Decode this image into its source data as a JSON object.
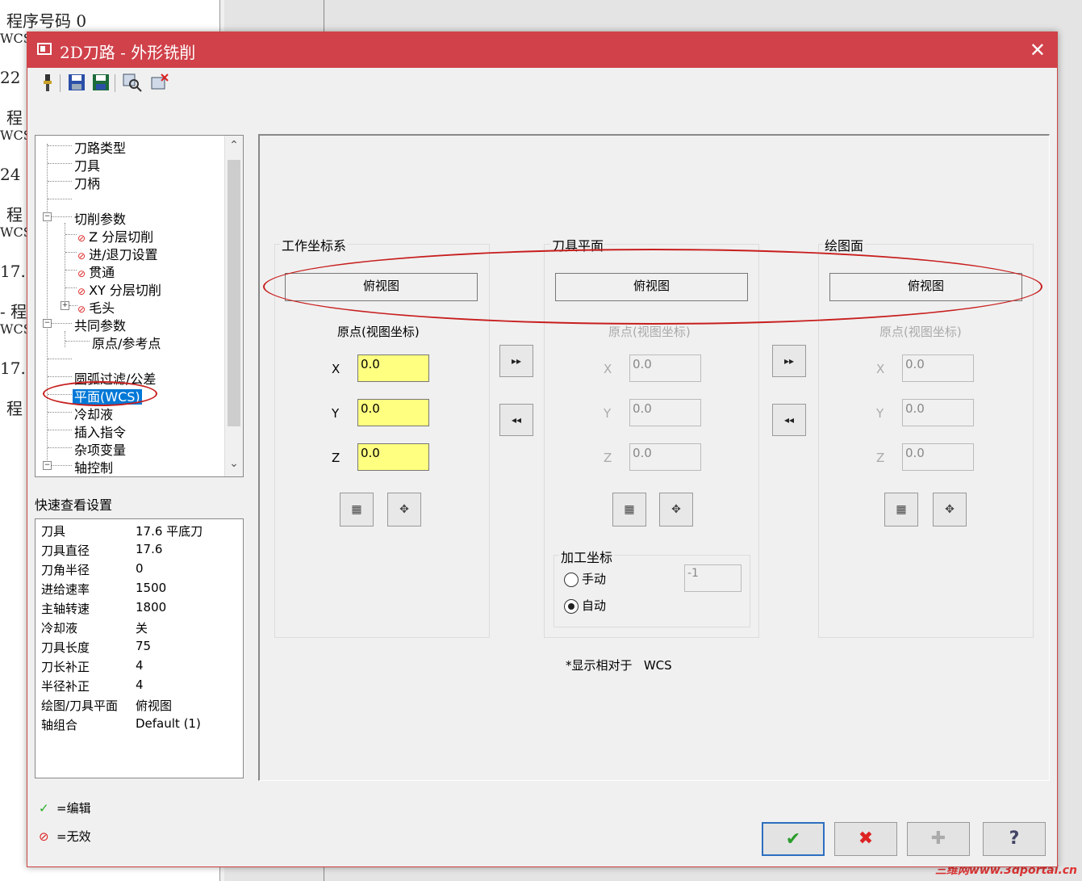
{
  "background": {
    "lines": [
      "程序号码 0",
      "WCS",
      "22",
      "程",
      "WCS",
      "24",
      "程",
      "WCS",
      "17.",
      "- 程",
      "WCS",
      "17.",
      "程"
    ],
    "watermark": "三维网www.3dportal.cn"
  },
  "window": {
    "title": "2D刀路 - 外形铣削",
    "close_label": "✕",
    "accent_color": "#d0414a"
  },
  "toolbar": {
    "icons": [
      "tool-icon",
      "save-icon",
      "save-all-icon",
      "preview-icon",
      "delete-icon"
    ]
  },
  "tree": {
    "items": [
      {
        "label": "刀路类型"
      },
      {
        "label": "刀具"
      },
      {
        "label": "刀柄"
      },
      {
        "label": "切削参数",
        "expander": "−"
      },
      {
        "label": "Z 分层切削"
      },
      {
        "label": "进/退刀设置"
      },
      {
        "label": "贯通"
      },
      {
        "label": "XY 分层切削"
      },
      {
        "label": "毛头",
        "expander": "+"
      },
      {
        "label": "共同参数",
        "expander": "−"
      },
      {
        "label": "原点/参考点"
      },
      {
        "label": "圆弧过滤/公差"
      },
      {
        "label": "平面(WCS)"
      },
      {
        "label": "冷却液"
      },
      {
        "label": "插入指令"
      },
      {
        "label": "杂项变量"
      },
      {
        "label": "轴控制",
        "expander": "−"
      }
    ],
    "invalid_glyph": "⊘"
  },
  "quick_view": {
    "title": "快速查看设置",
    "rows": [
      {
        "key": "刀具",
        "value": "17.6 平底刀"
      },
      {
        "key": "刀具直径",
        "value": "17.6"
      },
      {
        "key": "刀角半径",
        "value": "0"
      },
      {
        "key": "进给速率",
        "value": "1500"
      },
      {
        "key": "主轴转速",
        "value": "1800"
      },
      {
        "key": "冷却液",
        "value": "关"
      },
      {
        "key": "刀具长度",
        "value": "75"
      },
      {
        "key": "刀长补正",
        "value": "4"
      },
      {
        "key": "半径补正",
        "value": "4"
      },
      {
        "key": "绘图/刀具平面",
        "value": "俯视图"
      },
      {
        "key": "轴组合",
        "value": "Default (1)"
      }
    ]
  },
  "legend": {
    "edit_icon": "✓",
    "edit_label": "=编辑",
    "invalid_icon": "⊘",
    "invalid_label": "=无效"
  },
  "planes": {
    "origin_label": "原点(视图坐标)",
    "axes": [
      "X",
      "Y",
      "Z"
    ],
    "groups": [
      {
        "title": "工作坐标系",
        "view": "俯视图",
        "x": "0.0",
        "y": "0.0",
        "z": "0.0"
      },
      {
        "title": "刀具平面",
        "view": "俯视图",
        "x": "0.0",
        "y": "0.0",
        "z": "0.0"
      },
      {
        "title": "绘图面",
        "view": "俯视图",
        "x": "0.0",
        "y": "0.0",
        "z": "0.0"
      }
    ],
    "copy_right_glyph": "▸▸",
    "copy_left_glyph": "◂◂",
    "machining_coords": {
      "title": "加工坐标",
      "manual": "手动",
      "auto": "自动",
      "selected": "auto",
      "value": "-1"
    },
    "note_prefix": "*显示相对于",
    "note_value": "WCS"
  },
  "buttons": {
    "ok": "✔",
    "cancel": "✖",
    "add": "✚",
    "help": "?"
  }
}
